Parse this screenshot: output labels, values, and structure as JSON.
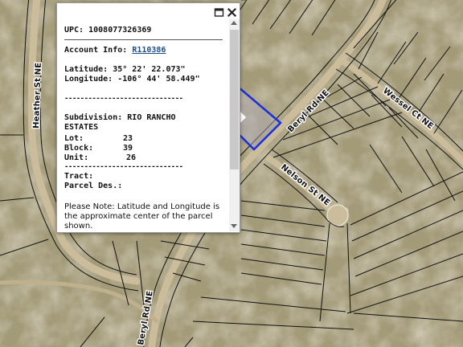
{
  "map": {
    "streets": {
      "heather": "Heather St NE",
      "beryl_upper": "Beryl Rd NE",
      "beryl_lower": "Beryl Rd NE",
      "wessel": "Wessel Ct NE",
      "nelson": "Nelson St NE"
    },
    "parcel_outline_color": "#1a2fd8",
    "lot_line_color": "#111111",
    "ground_color": "#a39a78"
  },
  "popup": {
    "controls": {
      "maximize_icon": "maximize-icon",
      "close_icon": "close-icon"
    },
    "upc_label": "UPC:",
    "upc_value": "1008077326369",
    "account_label": "Account Info:",
    "account_value": "R110386",
    "latitude_label": "Latitude:",
    "latitude_value": "35° 22' 22.073\"",
    "longitude_label": "Longitude:",
    "longitude_value": "-106° 44' 58.449\"",
    "divider": "------------------------------",
    "subdivision_label": "Subdivision:",
    "subdivision_value_line1": "RIO RANCHO",
    "subdivision_value_line2": "ESTATES",
    "lot_label": "Lot:",
    "lot_value": "23",
    "block_label": "Block:",
    "block_value": "39",
    "unit_label": "Unit:",
    "unit_value": "26",
    "tract_label": "Tract:",
    "parcel_des_label": "Parcel Des.:",
    "note_line1": "Please Note: Latitude and Longitude is",
    "note_line2": "the approximate center of the parcel",
    "note_line3": "shown."
  }
}
